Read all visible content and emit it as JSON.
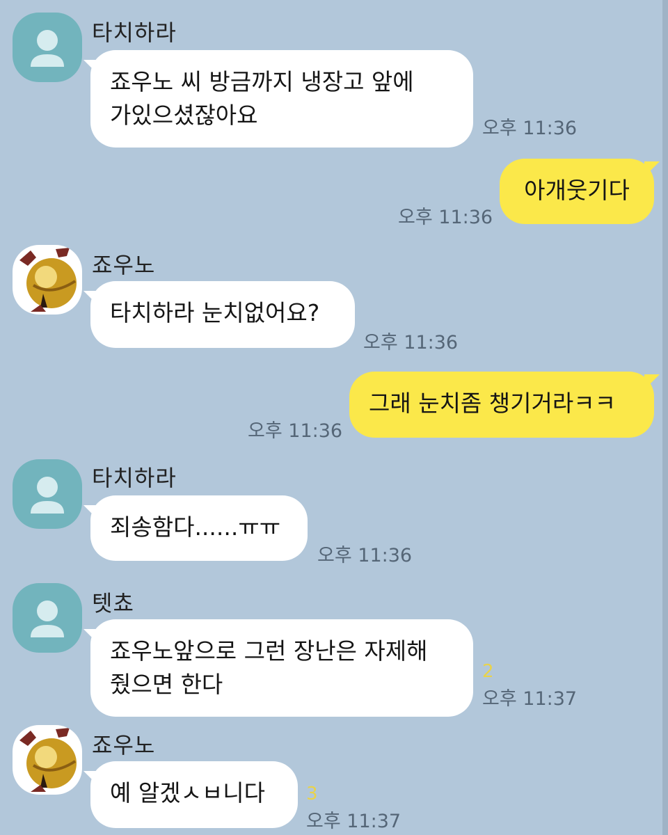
{
  "messages": [
    {
      "sender": "타치하라",
      "text": "죠우노 씨 방금까지 냉장고 앞에\n가있으셨잖아요",
      "time": "오후 11:36"
    },
    {
      "text": "아개웃기다",
      "time": "오후 11:36"
    },
    {
      "sender": "죠우노",
      "text": "타치하라 눈치없어요?",
      "time": "오후 11:36"
    },
    {
      "text": "그래 눈치좀 챙기거라ㅋㅋ",
      "time": "오후 11:36"
    },
    {
      "sender": "타치하라",
      "text": "죄송함다......ㅠㅠ",
      "time": "오후 11:36"
    },
    {
      "sender": "텟쵸",
      "text": "죠우노앞으로 그런 장난은 자제해\n줬으면 한다",
      "time": "오후 11:37",
      "unread": "2"
    },
    {
      "sender": "죠우노",
      "text": "예 알겠ㅅㅂ니다",
      "time": "오후 11:37",
      "unread": "3"
    }
  ],
  "colors": {
    "background": "#b2c7da",
    "incoming_bubble": "#ffffff",
    "outgoing_bubble": "#fbe84a",
    "default_avatar": "#72b4bd",
    "unread_count": "#e9d34a"
  },
  "icons": {
    "default_avatar": "person-silhouette-icon",
    "joono_avatar": "golden-bell-icon"
  }
}
